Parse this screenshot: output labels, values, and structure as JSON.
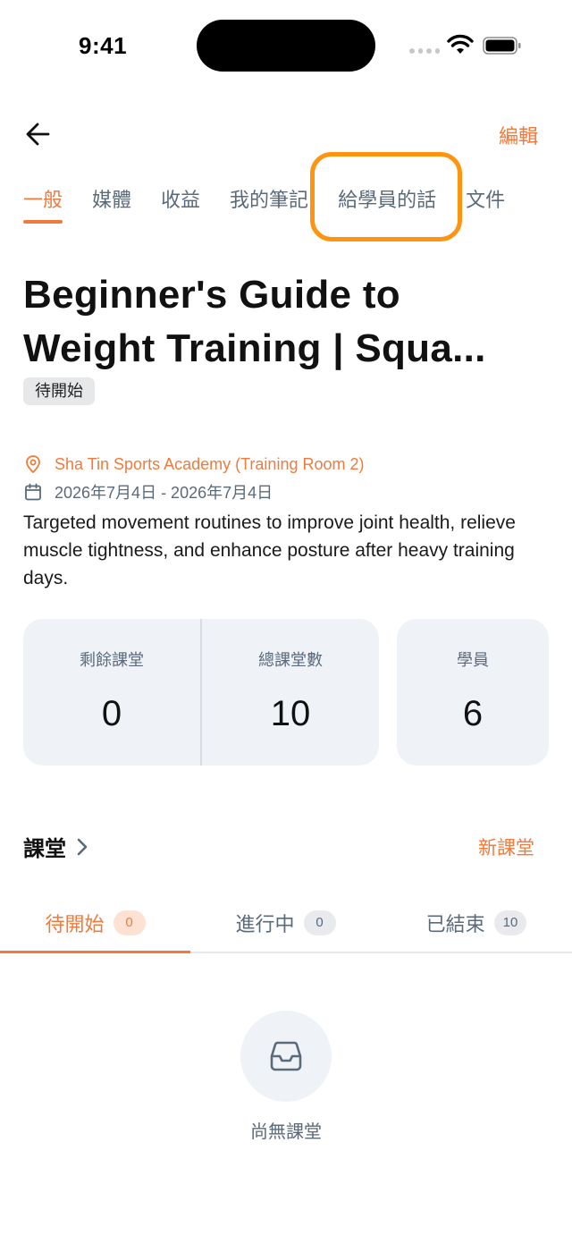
{
  "status_bar": {
    "time": "9:41"
  },
  "header": {
    "edit_label": "編輯"
  },
  "tabs": [
    {
      "label": "一般"
    },
    {
      "label": "媒體"
    },
    {
      "label": "收益"
    },
    {
      "label": "我的筆記"
    },
    {
      "label": "給學員的話"
    },
    {
      "label": "文件"
    }
  ],
  "course": {
    "title_line1": "Beginner's Guide to",
    "title_line2": "Weight Training | Squa...",
    "status": "待開始",
    "location": "Sha Tin Sports Academy (Training Room 2)",
    "date_range": "2026年7月4日 - 2026年7月4日",
    "description": "Targeted movement routines to improve joint health, relieve muscle tightness, and enhance posture after heavy training days."
  },
  "stats": {
    "remaining": {
      "label": "剩餘課堂",
      "value": "0"
    },
    "total": {
      "label": "總課堂數",
      "value": "10"
    },
    "students": {
      "label": "學員",
      "value": "6"
    }
  },
  "sessions": {
    "title": "課堂",
    "new_label": "新課堂",
    "tabs": [
      {
        "label": "待開始",
        "count": "0"
      },
      {
        "label": "進行中",
        "count": "0"
      },
      {
        "label": "已結束",
        "count": "10"
      }
    ],
    "empty_text": "尚無課堂"
  },
  "colors": {
    "accent": "#F07A3C",
    "highlight": "#FF9411",
    "muted_text": "#5b6a7b",
    "card_bg": "#eff3f8"
  },
  "icons": [
    "back-arrow-icon",
    "location-pin-icon",
    "calendar-icon",
    "chevron-right-icon",
    "inbox-icon",
    "wifi-icon",
    "battery-icon",
    "signal-icon"
  ]
}
